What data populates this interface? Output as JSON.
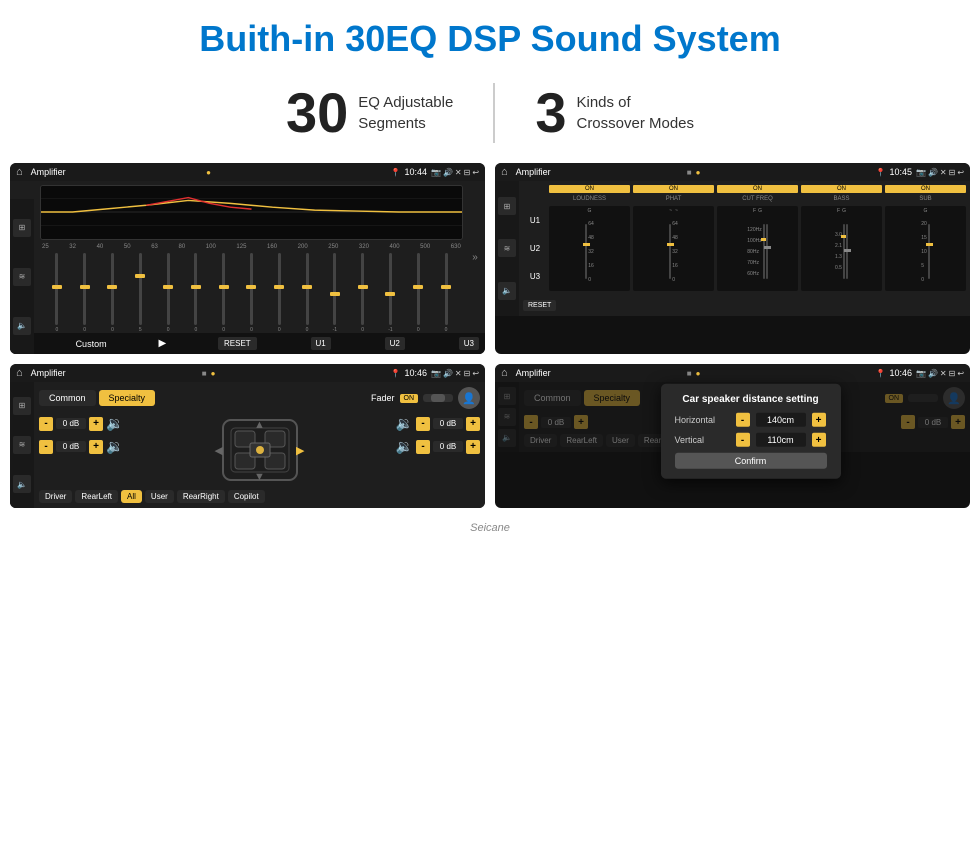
{
  "page": {
    "title": "Buith-in 30EQ DSP Sound System"
  },
  "stats": [
    {
      "number": "30",
      "text_line1": "EQ Adjustable",
      "text_line2": "Segments"
    },
    {
      "number": "3",
      "text_line1": "Kinds of",
      "text_line2": "Crossover Modes"
    }
  ],
  "screens": {
    "screen1": {
      "status_bar": {
        "title": "Amplifier",
        "time": "10:44"
      },
      "freq_labels": [
        "25",
        "32",
        "40",
        "50",
        "63",
        "80",
        "100",
        "125",
        "160",
        "200",
        "250",
        "320",
        "400",
        "500",
        "630"
      ],
      "slider_values": [
        "0",
        "0",
        "0",
        "5",
        "0",
        "0",
        "0",
        "0",
        "0",
        "0",
        "-1",
        "0",
        "-1"
      ],
      "bottom": {
        "preset": "Custom",
        "reset": "RESET",
        "u1": "U1",
        "u2": "U2",
        "u3": "U3"
      }
    },
    "screen2": {
      "status_bar": {
        "title": "Amplifier",
        "time": "10:45"
      },
      "u_labels": [
        "U1",
        "U2",
        "U3"
      ],
      "channels": [
        "LOUDNESS",
        "PHAT",
        "CUT FREQ",
        "BASS",
        "SUB"
      ],
      "reset_label": "RESET"
    },
    "screen3": {
      "status_bar": {
        "title": "Amplifier",
        "time": "10:46"
      },
      "tab_common": "Common",
      "tab_specialty": "Specialty",
      "fader_label": "Fader",
      "on_label": "ON",
      "db_values": [
        "0 dB",
        "0 dB",
        "0 dB",
        "0 dB"
      ],
      "buttons": {
        "driver": "Driver",
        "rear_left": "RearLeft",
        "all": "All",
        "user": "User",
        "rear_right": "RearRight",
        "copilot": "Copilot"
      }
    },
    "screen4": {
      "status_bar": {
        "title": "Amplifier",
        "time": "10:46"
      },
      "tab_common": "Common",
      "tab_specialty": "Specialty",
      "on_label": "ON",
      "dialog": {
        "title": "Car speaker distance setting",
        "horizontal_label": "Horizontal",
        "horizontal_value": "140cm",
        "vertical_label": "Vertical",
        "vertical_value": "110cm",
        "confirm_label": "Confirm"
      },
      "db_values": [
        "0 dB",
        "0 dB"
      ],
      "buttons": {
        "driver": "Driver",
        "rear_left": "RearLeft",
        "user": "User",
        "rear_right": "RearRight",
        "copilot": "Copilot"
      }
    }
  },
  "footer": {
    "brand": "Seicane"
  }
}
